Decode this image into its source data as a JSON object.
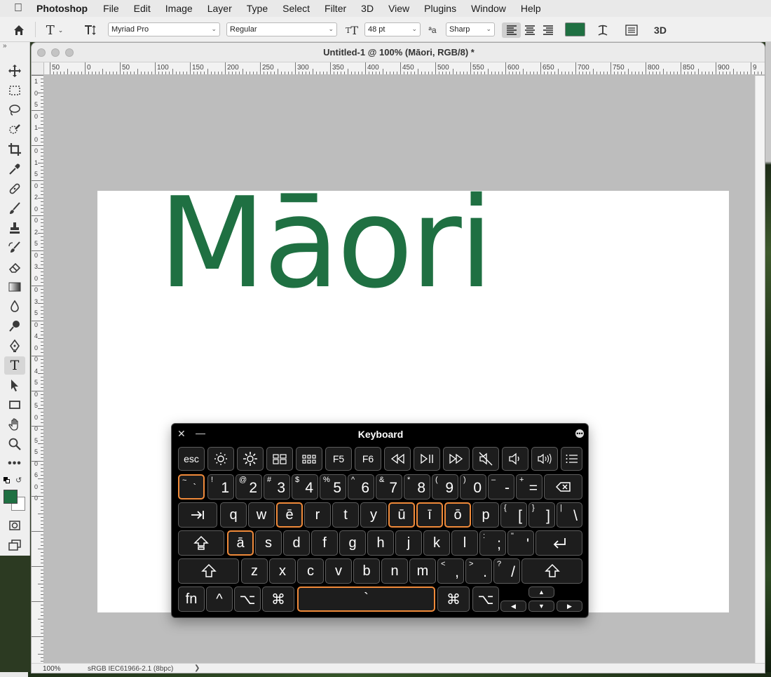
{
  "menubar": {
    "app_name": "Photoshop",
    "items": [
      "File",
      "Edit",
      "Image",
      "Layer",
      "Type",
      "Select",
      "Filter",
      "3D",
      "View",
      "Plugins",
      "Window",
      "Help"
    ]
  },
  "options_bar": {
    "font_family": "Myriad Pro",
    "font_style": "Regular",
    "font_size": "48 pt",
    "aa_label": "ªa",
    "antialias": "Sharp",
    "text_color": "#1f7042",
    "three_d_label": "3D"
  },
  "tools": {
    "collapse_label": "»",
    "items": [
      "move",
      "marquee",
      "lasso",
      "quick-select",
      "crop",
      "eyedropper",
      "healing",
      "brush",
      "stamp",
      "history-brush",
      "eraser",
      "gradient",
      "blur",
      "dodge",
      "pen",
      "type",
      "path-select",
      "rectangle",
      "hand",
      "zoom",
      "more"
    ]
  },
  "document": {
    "title": "Untitled-1 @ 100% (Māori, RGB/8) *",
    "canvas_text": "Māori",
    "text_color": "#1f7042",
    "ruler_top_labels": [
      "50",
      "0",
      "50",
      "100",
      "150",
      "200",
      "250",
      "300",
      "350",
      "400",
      "450",
      "500",
      "550",
      "600",
      "650",
      "700",
      "750",
      "800",
      "850",
      "900",
      "9"
    ],
    "ruler_left_labels": [
      "1",
      "0",
      "5",
      "0",
      "1",
      "0",
      "0",
      "1",
      "5",
      "0",
      "2",
      "0",
      "0",
      "2",
      "5",
      "0",
      "3",
      "0",
      "0",
      "3",
      "5",
      "0",
      "4",
      "0",
      "0",
      "4",
      "5",
      "0",
      "5",
      "0",
      "0",
      "5",
      "5",
      "0",
      "6",
      "0",
      "0"
    ],
    "zoom": "100%",
    "color_profile": "sRGB IEC61966-2.1 (8bpc)",
    "status_arrow": "❯"
  },
  "keyboard_viewer": {
    "title": "Keyboard",
    "close": "✕",
    "minimize": "—",
    "options": "•••",
    "highlight_color": "#f08a3a",
    "function_row": [
      "esc",
      "brightness-down",
      "brightness-up",
      "mission-control",
      "launchpad",
      "F5",
      "F6",
      "rewind",
      "play-pause",
      "fast-forward",
      "mute",
      "volume-down",
      "volume-up",
      "list"
    ],
    "f5": "F5",
    "f6": "F6",
    "esc": "esc",
    "number_row": [
      {
        "s": "~",
        "m": "`"
      },
      {
        "s": "!",
        "m": "1"
      },
      {
        "s": "@",
        "m": "2"
      },
      {
        "s": "#",
        "m": "3"
      },
      {
        "s": "$",
        "m": "4"
      },
      {
        "s": "%",
        "m": "5"
      },
      {
        "s": "^",
        "m": "6"
      },
      {
        "s": "&",
        "m": "7"
      },
      {
        "s": "*",
        "m": "8"
      },
      {
        "s": "(",
        "m": "9"
      },
      {
        "s": ")",
        "m": "0"
      },
      {
        "s": "–",
        "m": "-"
      },
      {
        "s": "+",
        "m": "="
      }
    ],
    "q_row": [
      {
        "m": "q"
      },
      {
        "m": "w"
      },
      {
        "m": "ē"
      },
      {
        "m": "r"
      },
      {
        "m": "t"
      },
      {
        "m": "y"
      },
      {
        "m": "ū"
      },
      {
        "m": "ī"
      },
      {
        "m": "ō"
      },
      {
        "m": "p"
      },
      {
        "s": "{",
        "m": "["
      },
      {
        "s": "}",
        "m": "]"
      },
      {
        "s": "|",
        "m": "\\"
      }
    ],
    "a_row": [
      {
        "m": "ā"
      },
      {
        "m": "s"
      },
      {
        "m": "d"
      },
      {
        "m": "f"
      },
      {
        "m": "g"
      },
      {
        "m": "h"
      },
      {
        "m": "j"
      },
      {
        "m": "k"
      },
      {
        "m": "l"
      },
      {
        "s": ":",
        "m": ";"
      },
      {
        "s": "\"",
        "m": "'"
      }
    ],
    "z_row": [
      {
        "m": "z"
      },
      {
        "m": "x"
      },
      {
        "m": "c"
      },
      {
        "m": "v"
      },
      {
        "m": "b"
      },
      {
        "m": "n"
      },
      {
        "m": "m"
      },
      {
        "s": "<",
        "m": ","
      },
      {
        "s": ">",
        "m": "."
      },
      {
        "s": "?",
        "m": "/"
      }
    ],
    "bottom_row": {
      "fn": "fn",
      "ctrl": "^",
      "opt": "⌥",
      "cmd": "⌘",
      "space": "`",
      "cmd_r": "⌘",
      "opt_r": "⌥"
    },
    "arrows": {
      "up": "▲",
      "left": "◀",
      "down": "▼",
      "right": "▶"
    }
  }
}
